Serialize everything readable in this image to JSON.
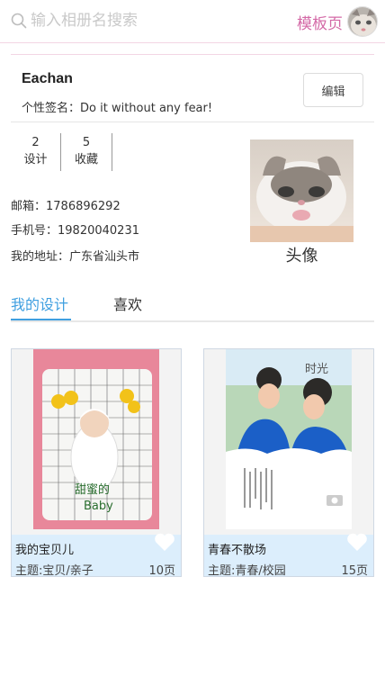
{
  "header": {
    "search_placeholder": "输入相册名搜索",
    "template_link": "模板页"
  },
  "profile": {
    "username": "Eachan",
    "signature_label": "个性签名：",
    "signature_text": "Do it without any fear!",
    "edit_label": "编辑",
    "stats": [
      {
        "value": "2",
        "label": "设计"
      },
      {
        "value": "5",
        "label": "收藏"
      }
    ],
    "email_label": "邮箱：",
    "email": "1786896292",
    "phone_label": "手机号：",
    "phone": "19820040231",
    "address_label": "我的地址：",
    "address": "广东省汕头市",
    "avatar_caption": "头像"
  },
  "tabs": [
    {
      "label": "我的设计",
      "active": true
    },
    {
      "label": "喜欢",
      "active": false
    }
  ],
  "designs": [
    {
      "title": "我的宝贝儿",
      "theme": "主题:宝贝/亲子",
      "pages": "10页",
      "img_text": "甜蜜的Baby"
    },
    {
      "title": "青春不散场",
      "theme": "主题:青春/校园",
      "pages": "15页",
      "img_text": "时光"
    }
  ],
  "colors": {
    "accent": "#3f9fe0",
    "pink": "#d46aa7",
    "card_footer": "#dceefc"
  }
}
